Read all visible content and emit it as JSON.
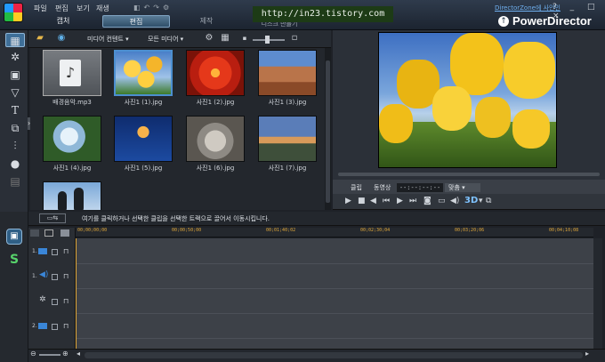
{
  "menu": [
    "파일",
    "편집",
    "보기",
    "재생"
  ],
  "tabs": {
    "capture": "캡처",
    "edit": "편집",
    "produce": "제작",
    "disc": "디스크 만들기"
  },
  "watermark_url": "http://in23.tistory.com",
  "director_zone": "DirectorZone에 사인인",
  "window_controls": "? _ □ ×",
  "brand": "PowerDirector",
  "library_toolbar": {
    "filter_label": "미디어 컨텐트",
    "media_label": "모든 미디어"
  },
  "library_items": [
    {
      "label": "배경음악.mp3",
      "kind": "audio"
    },
    {
      "label": "사진1 (1).jpg",
      "kind": "tulips"
    },
    {
      "label": "사진1 (2).jpg",
      "kind": "flower"
    },
    {
      "label": "사진1 (3).jpg",
      "kind": "desert"
    },
    {
      "label": "사진1 (4).jpg",
      "kind": "hydrangea"
    },
    {
      "label": "사진1 (5).jpg",
      "kind": "jellyfish"
    },
    {
      "label": "사진1 (6).jpg",
      "kind": "koala"
    },
    {
      "label": "사진1 (7).jpg",
      "kind": "lighthouse"
    },
    {
      "label": "",
      "kind": "penguins"
    }
  ],
  "preview": {
    "clip_label": "클립",
    "movie_label": "동영상",
    "timecode": "--:--:--:--",
    "fit_label": "맞춤",
    "mode_3d": "3D"
  },
  "instruction": "여기를 클릭하거나 선택한 클립을 선택한 트랙으로 끌어서 이동시킵니다.",
  "ruler_ticks": [
    "00;00;00;00",
    "00;00;50;00",
    "00;01;40;02",
    "00;02;30;04",
    "00;03;20;06",
    "00;04;10;08"
  ],
  "tracks": [
    {
      "num": "1.",
      "icon": "video-track-icon"
    },
    {
      "num": "1.",
      "icon": "audio-track-icon"
    },
    {
      "num": "",
      "icon": "effect-track-icon"
    },
    {
      "num": "2.",
      "icon": "video-track-icon"
    },
    {
      "num": "2.",
      "icon": "audio-track-icon"
    }
  ],
  "colors": {
    "accent": "#e0a83b",
    "selected_tab": "#2f4f69",
    "watermark_bg": "#1d3b16"
  }
}
